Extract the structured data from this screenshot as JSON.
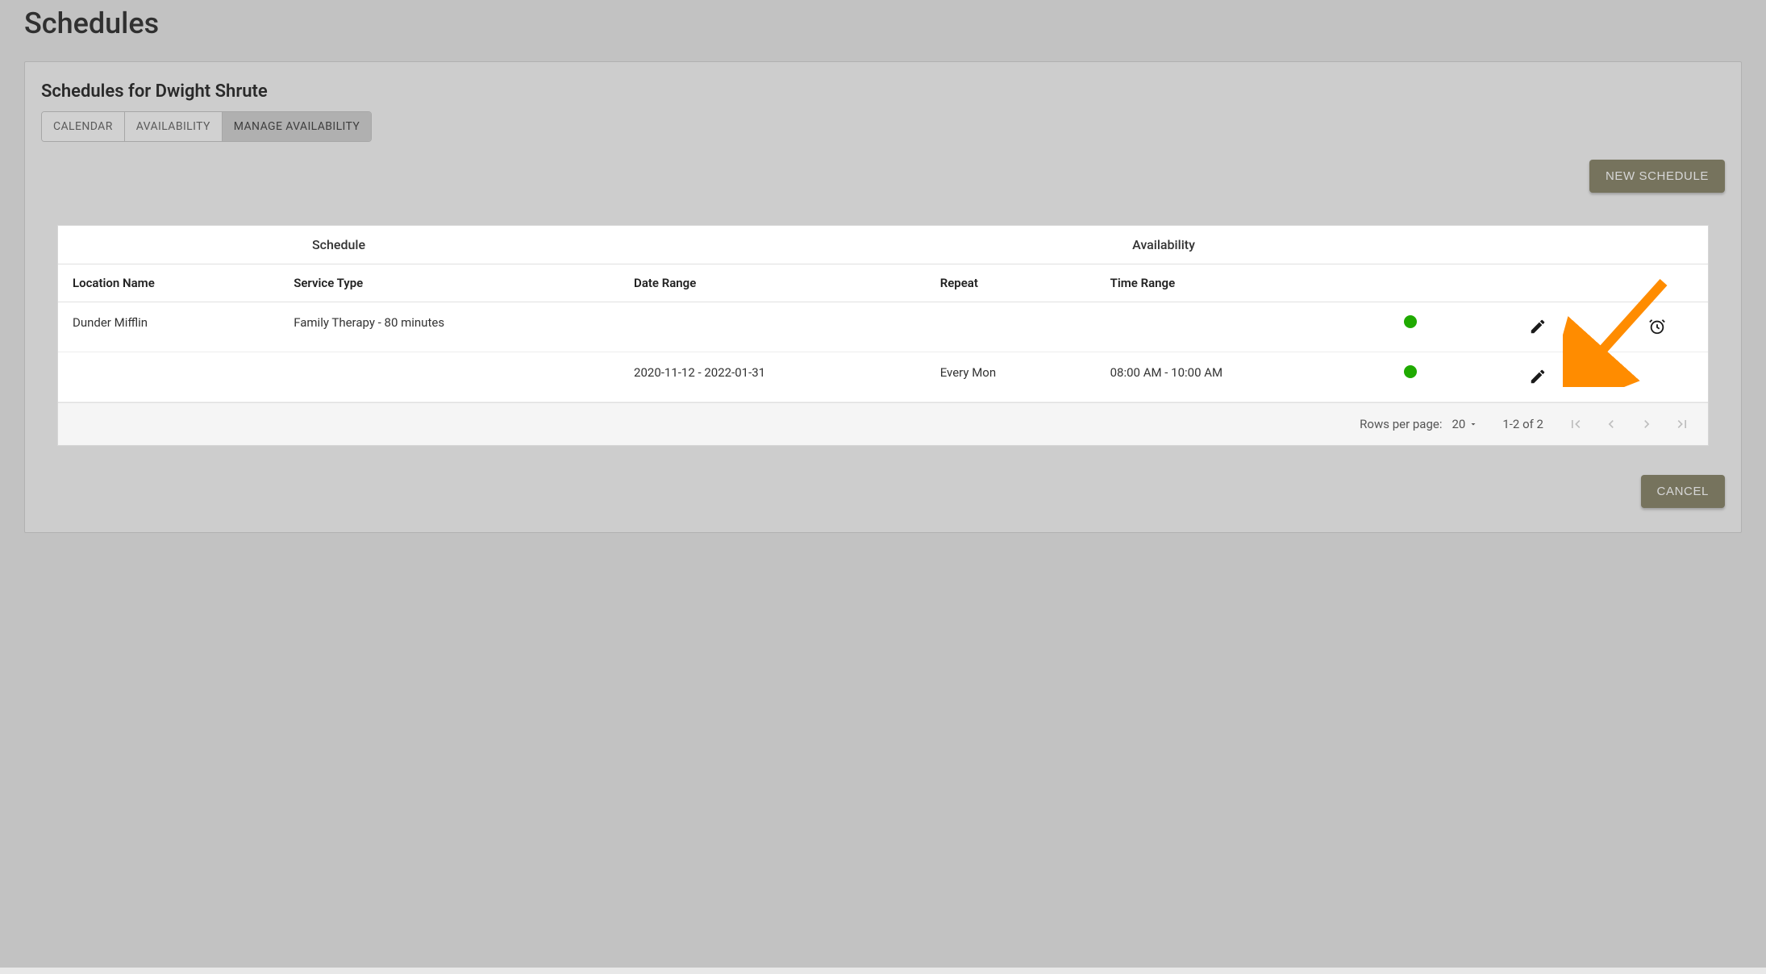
{
  "page": {
    "title": "Schedules"
  },
  "card": {
    "title": "Schedules for Dwight Shrute"
  },
  "tabs": {
    "items": [
      {
        "label": "CALENDAR"
      },
      {
        "label": "AVAILABILITY"
      },
      {
        "label": "MANAGE AVAILABILITY"
      }
    ],
    "activeIndex": 2
  },
  "buttons": {
    "newSchedule": "NEW SCHEDULE",
    "cancel": "CANCEL"
  },
  "table": {
    "groupHeaders": {
      "schedule": "Schedule",
      "availability": "Availability"
    },
    "headers": {
      "location": "Location Name",
      "serviceType": "Service Type",
      "dateRange": "Date Range",
      "repeat": "Repeat",
      "timeRange": "Time Range"
    },
    "rows": [
      {
        "location": "Dunder Mifflin",
        "serviceType": "Family Therapy - 80 minutes",
        "dateRange": "",
        "repeat": "",
        "timeRange": "",
        "statusColor": "#1faa00",
        "hasEdit": true,
        "hasClock": true
      },
      {
        "location": "",
        "serviceType": "",
        "dateRange": "2020-11-12 - 2022-01-31",
        "repeat": "Every Mon",
        "timeRange": "08:00 AM - 10:00 AM",
        "statusColor": "#1faa00",
        "hasEdit": true,
        "hasClock": false
      }
    ]
  },
  "pagination": {
    "rowsPerPageLabel": "Rows per page:",
    "rowsPerPageValue": "20",
    "rangeText": "1-2 of 2"
  }
}
